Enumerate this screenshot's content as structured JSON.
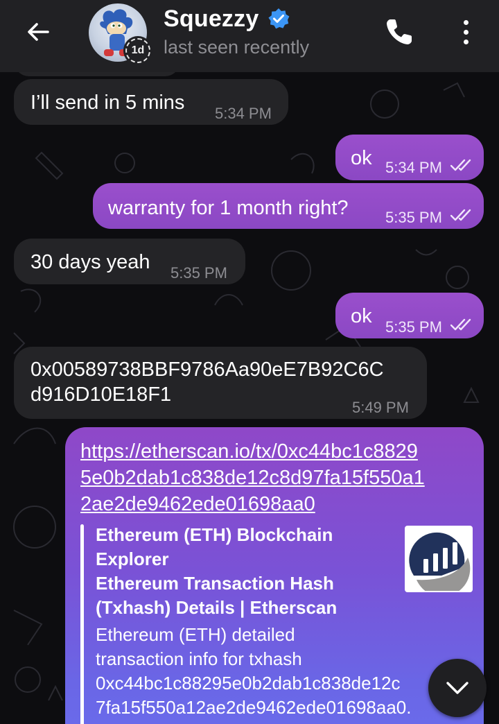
{
  "header": {
    "contact_name": "Squezzy",
    "status": "last seen recently",
    "story_badge": "1d",
    "icons": [
      "back-arrow-icon",
      "verified-badge-icon",
      "phone-icon",
      "more-vert-icon"
    ]
  },
  "messages": [
    {
      "dir": "in",
      "text": "I’ll send in 5 mins",
      "time": "5:34 PM"
    },
    {
      "dir": "out",
      "text": "ok",
      "time": "5:34 PM",
      "read": true
    },
    {
      "dir": "out",
      "text": "warranty for 1 month right?",
      "time": "5:35 PM",
      "read": true
    },
    {
      "dir": "in",
      "text": "30 days yeah",
      "time": "5:35 PM"
    },
    {
      "dir": "out",
      "text": "ok",
      "time": "5:35 PM",
      "read": true
    },
    {
      "dir": "in",
      "text": "0x00589738BBF9786Aa90eE7B92C6Cd916D10E18F1",
      "line1": "0x00589738BBF9786Aa90eE7B92C6C",
      "line2": "d916D10E18F1",
      "time": "5:49 PM"
    }
  ],
  "link_message": {
    "url_lines": [
      "https://etherscan.io/tx/0xc44bc1c8829",
      "5e0b2dab1c838de12c8d97fa15f550a1",
      "2ae2de9462ede01698aa0"
    ],
    "preview": {
      "site_lines": [
        "Ethereum (ETH) Blockchain",
        "Explorer"
      ],
      "title_lines": [
        "Ethereum Transaction Hash",
        "(Txhash) Details | Etherscan"
      ],
      "desc_lines": [
        "Ethereum (ETH) detailed",
        "transaction info for txhash",
        "0xc44bc1c88295e0b2dab1c838de12c",
        "7fa15f550a12ae2de9462ede01698aa0."
      ]
    }
  },
  "colors": {
    "header_bg": "#212124",
    "incoming_bubble": "#242427",
    "outgoing_bubble": "#9a4fcc",
    "link_gradient_end": "#6a6cec",
    "verified": "#3b95f5"
  }
}
